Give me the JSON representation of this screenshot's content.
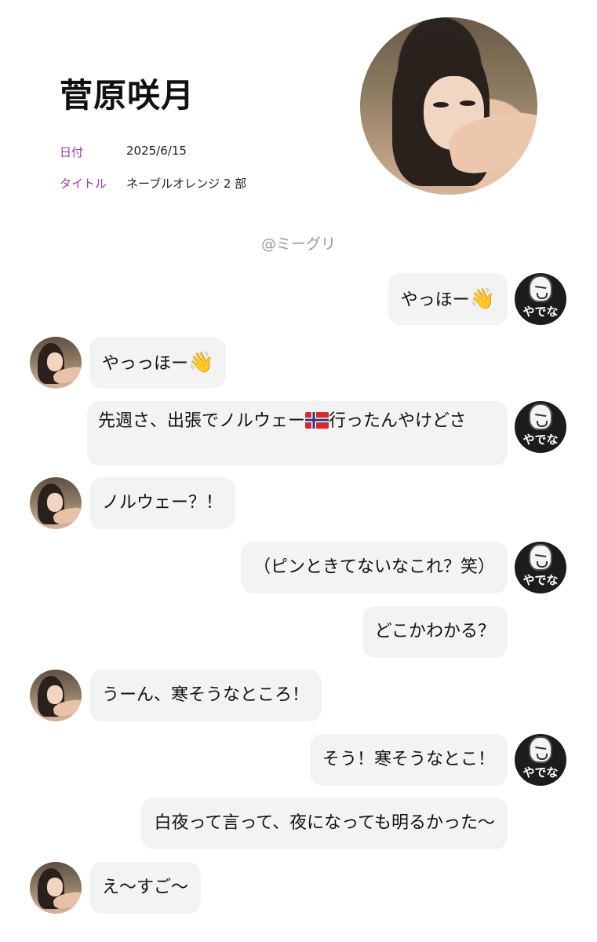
{
  "header": {
    "title": "菅原咲月",
    "date_label": "日付",
    "date_value": "2025/6/15",
    "title_label": "タイトル",
    "title_value": "ネーブルオレンジ 2 部",
    "accent_color": "#9a3fa6"
  },
  "handle": "@ミーグリ",
  "self_avatar_label": "やでな",
  "messages": [
    {
      "from": "self",
      "text": "やっほー",
      "emoji": "👋"
    },
    {
      "from": "other",
      "text": "やっっほー",
      "emoji": "👋"
    },
    {
      "from": "self",
      "text_before": "先週さ、出張でノルウェー",
      "flag": "norway-flag-icon",
      "text_after": "行ったんやけどさ"
    },
    {
      "from": "other",
      "text": "ノルウェー？！"
    },
    {
      "from": "self",
      "text": "（ピンときてないなこれ？笑）"
    },
    {
      "from": "self",
      "text": "どこかわかる？"
    },
    {
      "from": "other",
      "text": "うーん、寒そうなところ！"
    },
    {
      "from": "self",
      "text": "そう！寒そうなとこ！"
    },
    {
      "from": "self",
      "text": "白夜って言って、夜になっても明るかった〜"
    },
    {
      "from": "other",
      "text": "え〜すご〜"
    }
  ]
}
